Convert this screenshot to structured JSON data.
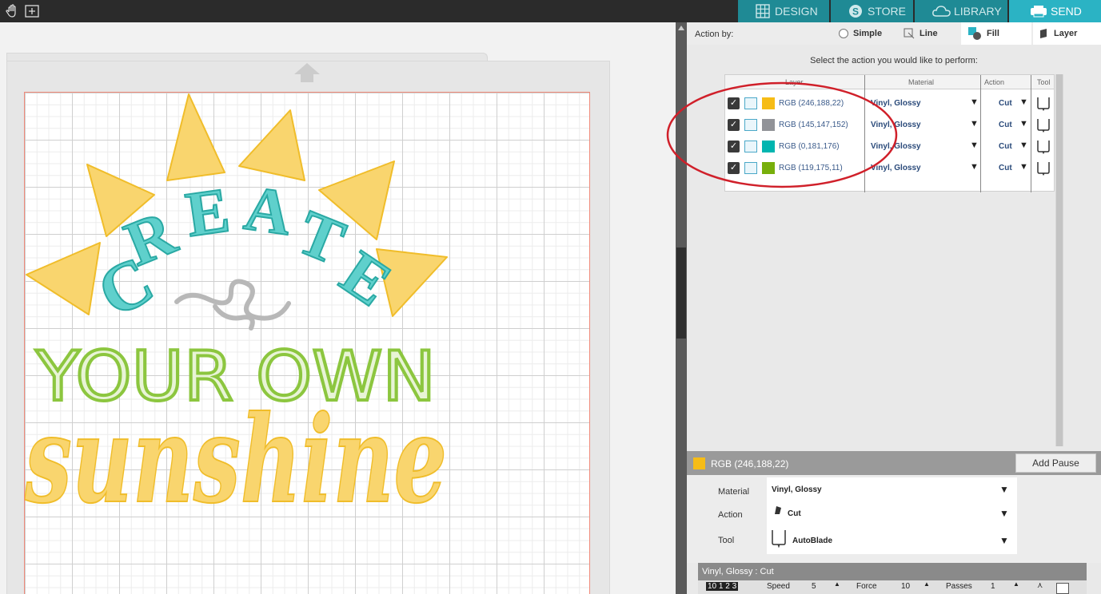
{
  "topbar": {
    "tabs": [
      {
        "label": "DESIGN",
        "icon": "grid-icon"
      },
      {
        "label": "STORE",
        "icon": "store-s-icon"
      },
      {
        "label": "LIBRARY",
        "icon": "cloud-icon"
      },
      {
        "label": "SEND",
        "icon": "printer-icon",
        "active": true
      }
    ],
    "tools": [
      "hand-icon",
      "add-page-icon"
    ]
  },
  "artwork": {
    "line1": "CREATE",
    "line2": "YOUR OWN",
    "line3": "sunshine",
    "colors": {
      "sun": "#f9d56e",
      "teal": "#5fd0cc",
      "grey": "#b8b8b8",
      "green": "#8cc63f"
    }
  },
  "panel": {
    "action_by_label": "Action by:",
    "options": [
      {
        "label": "Simple"
      },
      {
        "label": "Line"
      },
      {
        "label": "Fill",
        "active": true
      },
      {
        "label": "Layer"
      }
    ],
    "prompt": "Select the action you would like to perform:",
    "table": {
      "headers": {
        "layer": "Layer",
        "material": "Material",
        "action": "Action",
        "tool": "Tool"
      },
      "rows": [
        {
          "color": "#f6bc16",
          "rgb": "RGB (246,188,22)",
          "material": "Vinyl, Glossy",
          "action": "Cut"
        },
        {
          "color": "#919398",
          "rgb": "RGB (145,147,152)",
          "material": "Vinyl, Glossy",
          "action": "Cut"
        },
        {
          "color": "#00b5b0",
          "rgb": "RGB (0,181,176)",
          "material": "Vinyl, Glossy",
          "action": "Cut"
        },
        {
          "color": "#77af0b",
          "rgb": "RGB (119,175,11)",
          "material": "Vinyl, Glossy",
          "action": "Cut"
        }
      ]
    },
    "selected": {
      "rgb": "RGB (246,188,22)",
      "add_pause": "Add Pause"
    },
    "props": {
      "material_label": "Material",
      "material_value": "Vinyl, Glossy",
      "action_label": "Action",
      "action_value": "Cut",
      "tool_label": "Tool",
      "tool_value": "AutoBlade"
    },
    "cut_summary": "Vinyl, Glossy : Cut",
    "bottom": {
      "blade": "10 1 2 3",
      "speed": "Speed",
      "speed_val": "5",
      "force": "Force",
      "force_val": "10",
      "passes": "Passes",
      "passes_val": "1"
    }
  }
}
